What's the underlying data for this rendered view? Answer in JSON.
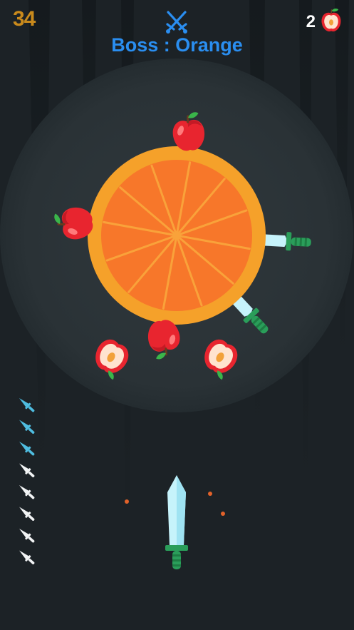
{
  "hud": {
    "score": "34",
    "boss_label": "Boss : Orange",
    "apple_count": "2"
  },
  "boss": {
    "name": "Orange",
    "segments": 12
  },
  "knives_remaining": {
    "total": 8,
    "used": 3
  },
  "colors": {
    "background": "#1c2226",
    "score": "#c98a1c",
    "boss_label": "#2a8ef0",
    "orange_rind": "#f5a12a",
    "orange_flesh": "#f7772a",
    "apple_red": "#e8252f",
    "leaf_green": "#3ab54a",
    "blade_light": "#c6f3fb",
    "knife_used_blue": "#4fbde0",
    "knife_available_white": "#f2f4f5",
    "handle_green": "#2a9e5a"
  },
  "icons": {
    "versus": "crossed-swords-icon",
    "apples": "apple-icon"
  }
}
